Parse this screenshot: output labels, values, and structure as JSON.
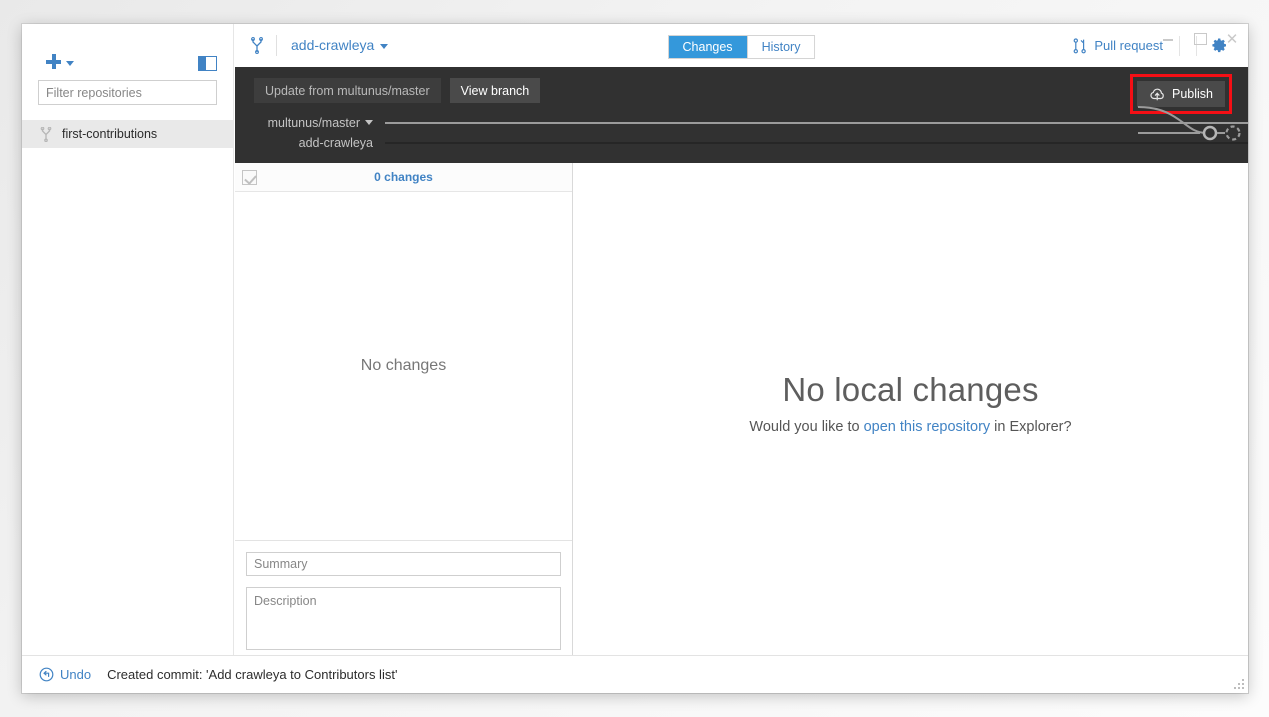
{
  "window": {
    "controls": {
      "minimize": "–",
      "maximize": "□",
      "close": "✕"
    }
  },
  "sidebar": {
    "add_repo_icon": "plus-icon",
    "add_repo_caret": "chevron-down-icon",
    "panel_toggle_icon": "panel-toggle-icon",
    "filter": {
      "placeholder": "Filter repositories",
      "value": ""
    },
    "repositories": [
      {
        "name": "first-contributions",
        "icon": "branch-icon",
        "selected": true
      }
    ]
  },
  "header": {
    "branch_icon": "branch-icon",
    "branch_name": "add-crawleya",
    "branch_caret": "chevron-down-icon",
    "tabs": [
      {
        "label": "Changes",
        "active": true
      },
      {
        "label": "History",
        "active": false
      }
    ],
    "pull_request": {
      "label": "Pull request",
      "icon": "pull-request-icon"
    },
    "settings_icon": "gear-icon"
  },
  "toolbar": {
    "update_button": "Update from multunus/master",
    "view_branch_button": "View branch",
    "publish_button": "Publish",
    "publish_icon": "cloud-upload-icon",
    "highlight_color": "#f50f15",
    "background_color": "#313131",
    "graph": {
      "rows": [
        {
          "label": "multunus/master",
          "has_caret": true,
          "line_color": "#9b9b9b"
        },
        {
          "label": "add-crawleya",
          "has_caret": false,
          "line_color": "#262626"
        }
      ]
    }
  },
  "changes_panel": {
    "select_all_checked": true,
    "count_label": "0 changes",
    "empty_text": "No changes",
    "summary": {
      "placeholder": "Summary",
      "value": ""
    },
    "description": {
      "placeholder": "Description",
      "value": ""
    }
  },
  "detail_panel": {
    "title": "No local changes",
    "subtitle_before": "Would you like to ",
    "subtitle_link": "open this repository",
    "subtitle_after": " in Explorer?"
  },
  "status_bar": {
    "undo_label": "Undo",
    "undo_icon": "undo-icon",
    "message": "Created commit: 'Add crawleya to Contributors list'"
  },
  "colors": {
    "accent_blue": "#4183c4",
    "tab_active_blue": "#3498db",
    "highlight_red": "#f50f15",
    "dark_toolbar": "#313131"
  }
}
